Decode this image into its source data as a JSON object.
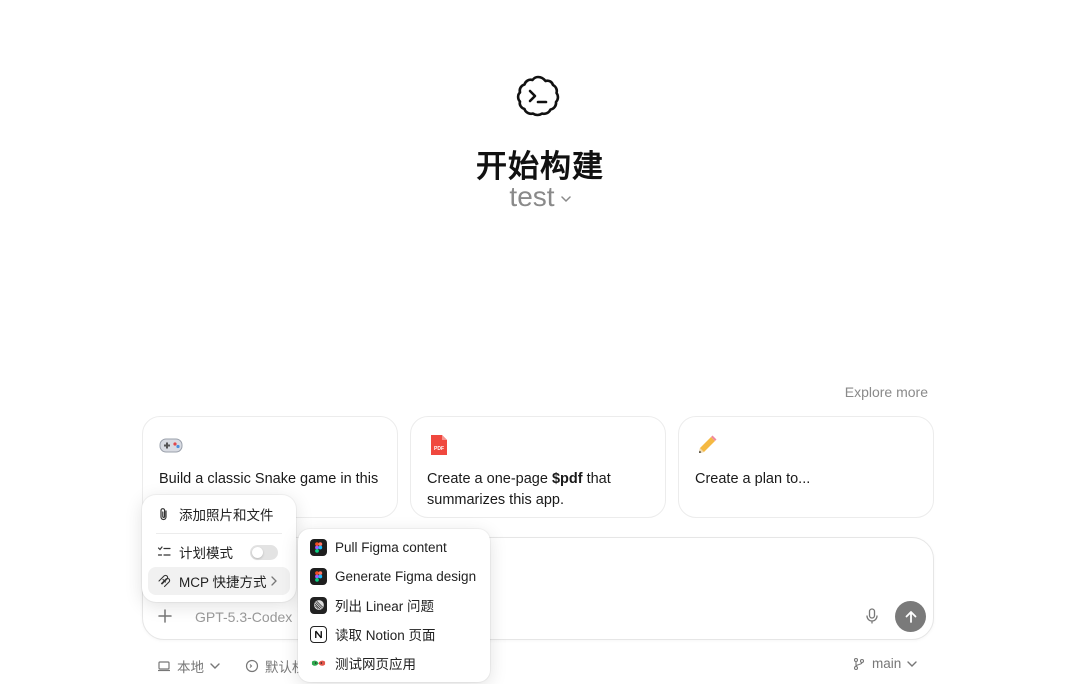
{
  "hero": {
    "logo_icon": "codex-cloud-terminal-icon",
    "title": "开始构建",
    "project": "test"
  },
  "explore_more": "Explore more",
  "cards": [
    {
      "icon": "game-controller-icon",
      "emoji": "🎮",
      "text": "Build a classic Snake game in this repo."
    },
    {
      "icon": "pdf-file-icon",
      "text_pre": "Create a one-page ",
      "text_bold": "$pdf",
      "text_post": " that summarizes this app."
    },
    {
      "icon": "pencil-icon",
      "emoji": "✏️",
      "text": "Create a plan to..."
    }
  ],
  "composer": {
    "model": "GPT-5.3-Codex"
  },
  "bottom": {
    "local": "本地",
    "permission": "默认权限",
    "branch": "main"
  },
  "menu": {
    "items": [
      {
        "label": "添加照片和文件",
        "icon": "paperclip-icon"
      },
      {
        "label": "计划模式",
        "icon": "checklist-icon",
        "toggle": false
      },
      {
        "label": "MCP 快捷方式",
        "icon": "mcp-icon"
      }
    ]
  },
  "submenu": {
    "items": [
      {
        "label": "Pull Figma content",
        "icon": "figma-icon"
      },
      {
        "label": "Generate Figma design",
        "icon": "figma-icon"
      },
      {
        "label": "列出 Linear 问题",
        "icon": "linear-icon"
      },
      {
        "label": "读取 Notion 页面",
        "icon": "notion-icon"
      },
      {
        "label": "测试网页应用",
        "icon": "playwright-icon"
      }
    ]
  },
  "colors": {
    "send_button": "#7a7a7a",
    "pdf_red": "#f0483e"
  }
}
